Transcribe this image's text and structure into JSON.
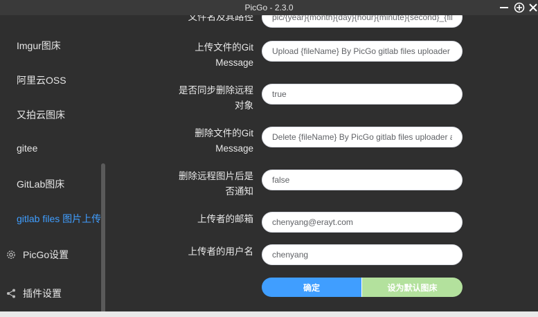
{
  "window": {
    "title": "PicGo - 2.3.0"
  },
  "sidebar": {
    "items": [
      {
        "label": "Imgur图床"
      },
      {
        "label": "阿里云OSS"
      },
      {
        "label": "又拍云图床"
      },
      {
        "label": "gitee"
      },
      {
        "label": "GitLab图床"
      },
      {
        "label": "gitlab files 图片上传",
        "active": true
      }
    ],
    "settings_label": "PicGo设置",
    "plugins_label": "插件设置"
  },
  "form": {
    "fields": [
      {
        "label": "文件名及其路径",
        "value": "pic/{year}{month}{day}{hour}{minute}{second}_{fileName}"
      },
      {
        "label": "上传文件的Git Message",
        "value": "Upload {fileName} By PicGo gitlab files uploader"
      },
      {
        "label": "是否同步删除远程对象",
        "value": "true"
      },
      {
        "label": "删除文件的Git Message",
        "value": "Delete {fileName} By PicGo gitlab files uploader at {date}"
      },
      {
        "label": "删除远程图片后是否通知",
        "value": "false"
      },
      {
        "label": "上传者的邮箱",
        "value": "chenyang@erayt.com"
      },
      {
        "label": "上传者的用户名",
        "value": "chenyang"
      }
    ],
    "confirm_label": "确定",
    "set_default_label": "设为默认图床"
  },
  "colors": {
    "accent": "#409eff",
    "success_light": "#b3e19d",
    "background": "#2f2f2f"
  }
}
